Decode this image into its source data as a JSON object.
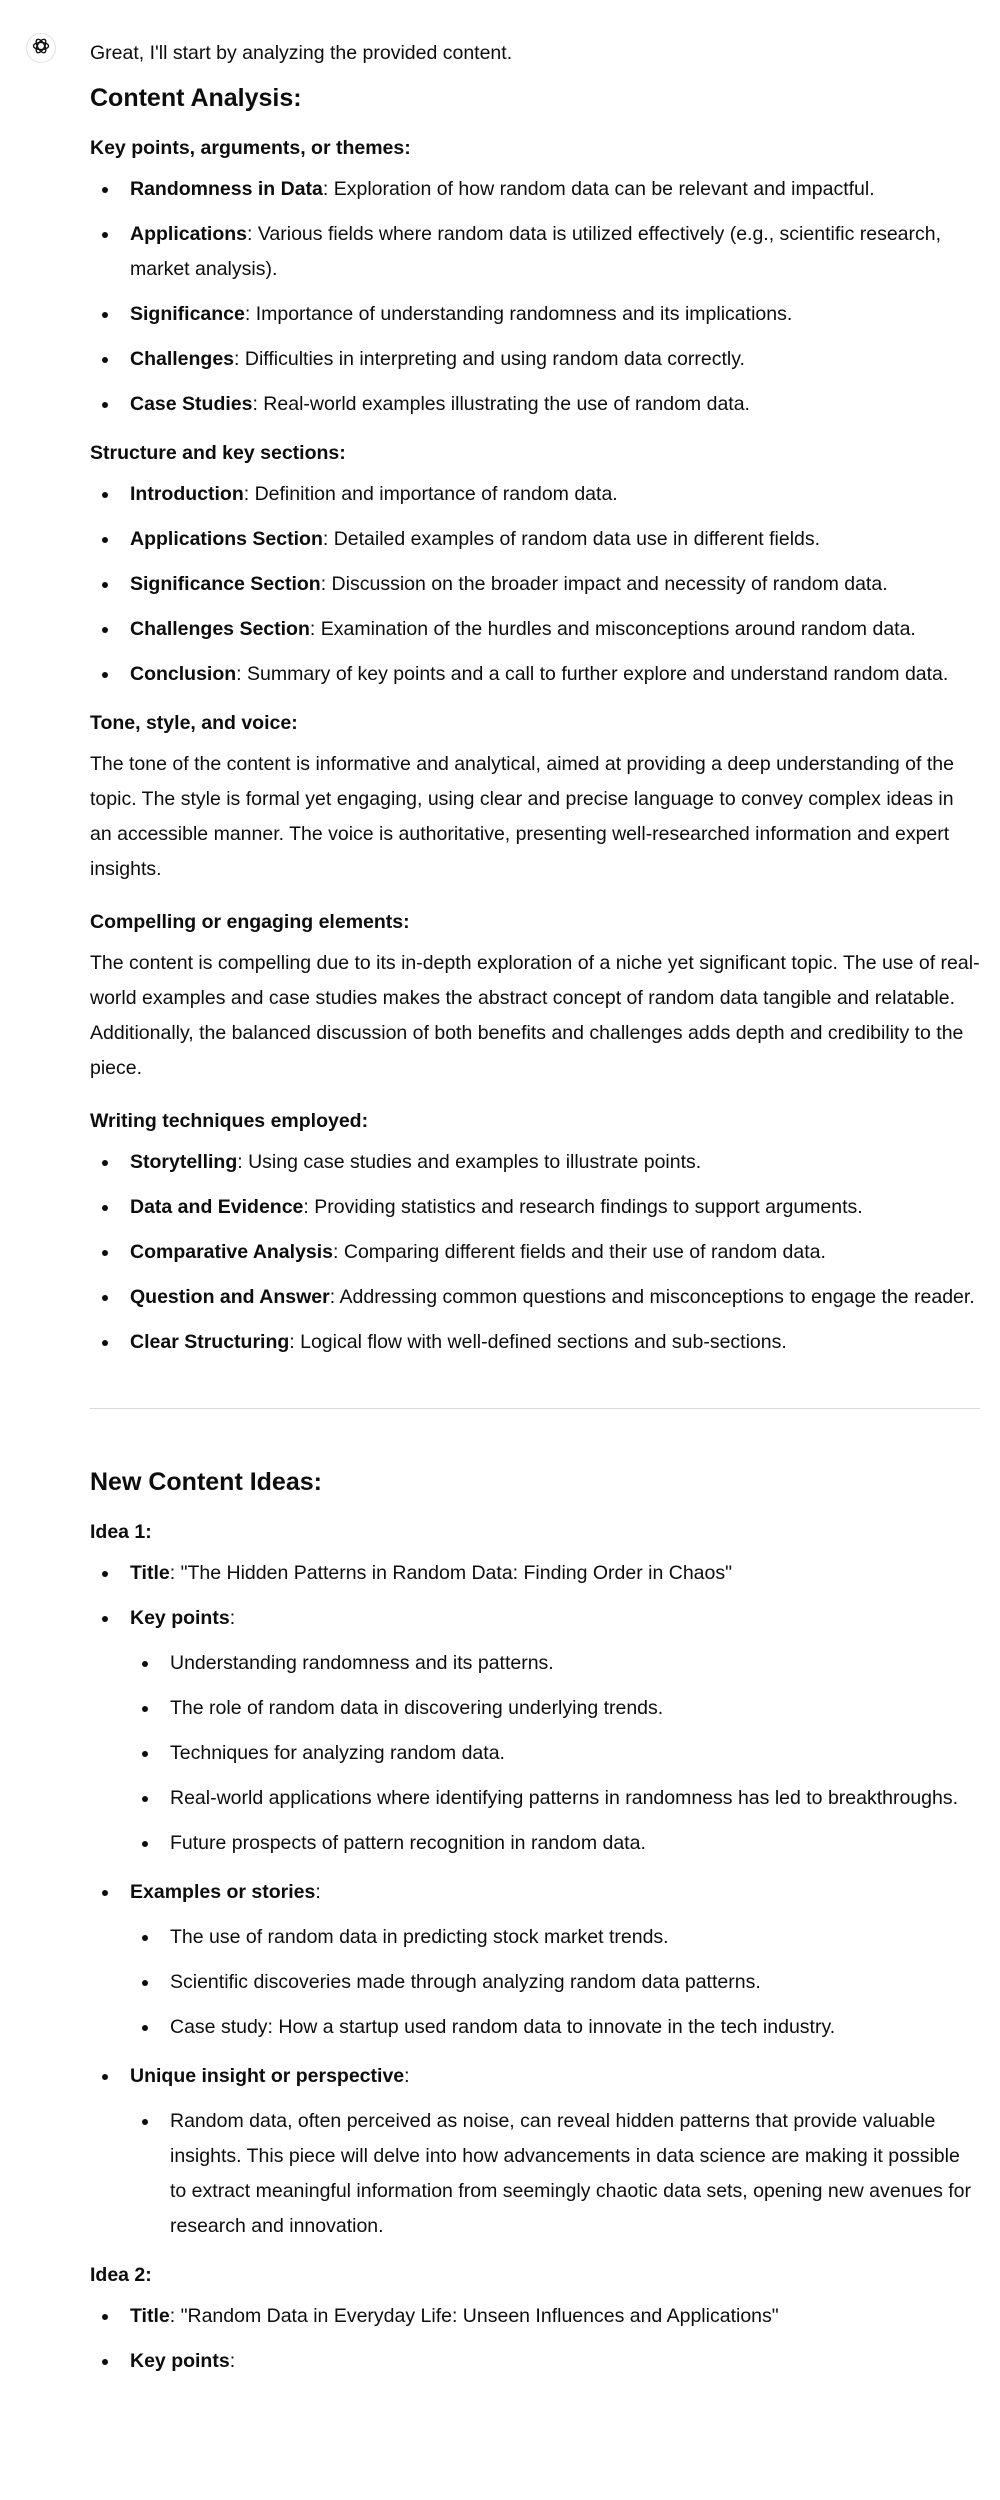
{
  "assistant": {
    "icon": "openai-logo-icon"
  },
  "intro": "Great, I'll start by analyzing the provided content.",
  "analysis": {
    "heading": "Content Analysis:",
    "key_points": {
      "label": "Key points, arguments, or themes:",
      "items": [
        {
          "term": "Randomness in Data",
          "text": ": Exploration of how random data can be relevant and impactful."
        },
        {
          "term": "Applications",
          "text": ": Various fields where random data is utilized effectively (e.g., scientific research, market analysis)."
        },
        {
          "term": "Significance",
          "text": ": Importance of understanding randomness and its implications."
        },
        {
          "term": "Challenges",
          "text": ": Difficulties in interpreting and using random data correctly."
        },
        {
          "term": "Case Studies",
          "text": ": Real-world examples illustrating the use of random data."
        }
      ]
    },
    "structure": {
      "label": "Structure and key sections:",
      "items": [
        {
          "term": "Introduction",
          "text": ": Definition and importance of random data."
        },
        {
          "term": "Applications Section",
          "text": ": Detailed examples of random data use in different fields."
        },
        {
          "term": "Significance Section",
          "text": ": Discussion on the broader impact and necessity of random data."
        },
        {
          "term": "Challenges Section",
          "text": ": Examination of the hurdles and misconceptions around random data."
        },
        {
          "term": "Conclusion",
          "text": ": Summary of key points and a call to further explore and understand random data."
        }
      ]
    },
    "tone": {
      "label": "Tone, style, and voice:",
      "text": "The tone of the content is informative and analytical, aimed at providing a deep understanding of the topic. The style is formal yet engaging, using clear and precise language to convey complex ideas in an accessible manner. The voice is authoritative, presenting well-researched information and expert insights."
    },
    "compelling": {
      "label": "Compelling or engaging elements:",
      "text": "The content is compelling due to its in-depth exploration of a niche yet significant topic. The use of real-world examples and case studies makes the abstract concept of random data tangible and relatable. Additionally, the balanced discussion of both benefits and challenges adds depth and credibility to the piece."
    },
    "techniques": {
      "label": "Writing techniques employed:",
      "items": [
        {
          "term": "Storytelling",
          "text": ": Using case studies and examples to illustrate points."
        },
        {
          "term": "Data and Evidence",
          "text": ": Providing statistics and research findings to support arguments."
        },
        {
          "term": "Comparative Analysis",
          "text": ": Comparing different fields and their use of random data."
        },
        {
          "term": "Question and Answer",
          "text": ": Addressing common questions and misconceptions to engage the reader."
        },
        {
          "term": "Clear Structuring",
          "text": ": Logical flow with well-defined sections and sub-sections."
        }
      ]
    }
  },
  "ideas": {
    "heading": "New Content Ideas:",
    "idea1": {
      "label": "Idea 1:",
      "title_term": "Title",
      "title_text": ": \"The Hidden Patterns in Random Data: Finding Order in Chaos\"",
      "key_points_term": "Key points",
      "key_points_suffix": ":",
      "key_points": [
        "Understanding randomness and its patterns.",
        "The role of random data in discovering underlying trends.",
        "Techniques for analyzing random data.",
        "Real-world applications where identifying patterns in randomness has led to breakthroughs.",
        "Future prospects of pattern recognition in random data."
      ],
      "examples_term": "Examples or stories",
      "examples_suffix": ":",
      "examples": [
        "The use of random data in predicting stock market trends.",
        "Scientific discoveries made through analyzing random data patterns.",
        "Case study: How a startup used random data to innovate in the tech industry."
      ],
      "insight_term": "Unique insight or perspective",
      "insight_suffix": ":",
      "insight": "Random data, often perceived as noise, can reveal hidden patterns that provide valuable insights. This piece will delve into how advancements in data science are making it possible to extract meaningful information from seemingly chaotic data sets, opening new avenues for research and innovation."
    },
    "idea2": {
      "label": "Idea 2:",
      "title_term": "Title",
      "title_text": ": \"Random Data in Everyday Life: Unseen Influences and Applications\"",
      "key_points_term": "Key points",
      "key_points_suffix": ":"
    }
  }
}
